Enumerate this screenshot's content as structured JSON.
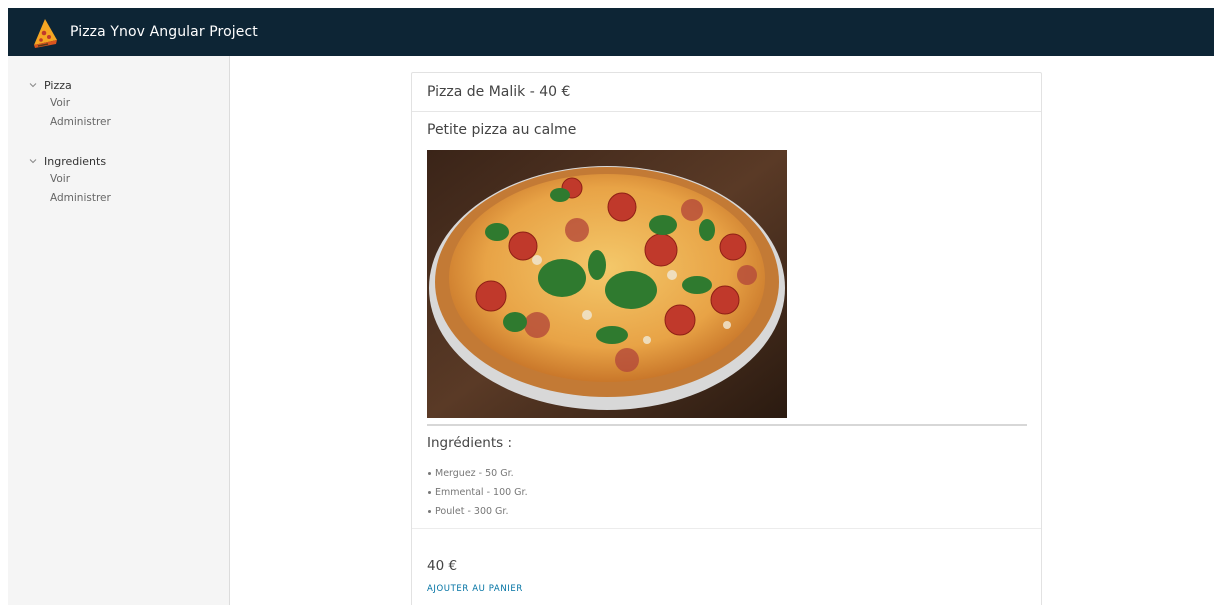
{
  "header": {
    "title": "Pizza Ynov Angular Project",
    "logo_icon": "pizza-slice-icon",
    "background": "#0d2535"
  },
  "sidebar": {
    "groups": [
      {
        "label": "Pizza",
        "icon": "chevron-down-icon",
        "items": [
          {
            "label": "Voir"
          },
          {
            "label": "Administrer"
          }
        ]
      },
      {
        "label": "Ingredients",
        "icon": "chevron-down-icon",
        "items": [
          {
            "label": "Voir"
          },
          {
            "label": "Administrer"
          }
        ]
      }
    ]
  },
  "card": {
    "header": "Pizza de Malik - 40 €",
    "subtitle": "Petite pizza au calme",
    "ingredients_title": "Ingrédients :",
    "ingredients": [
      "Merguez - 50 Gr.",
      "Emmental - 100 Gr.",
      "Poulet - 300 Gr."
    ],
    "price": "40 €",
    "add_to_cart": "AJOUTER AU PANIER",
    "accent": "#0072a3"
  }
}
